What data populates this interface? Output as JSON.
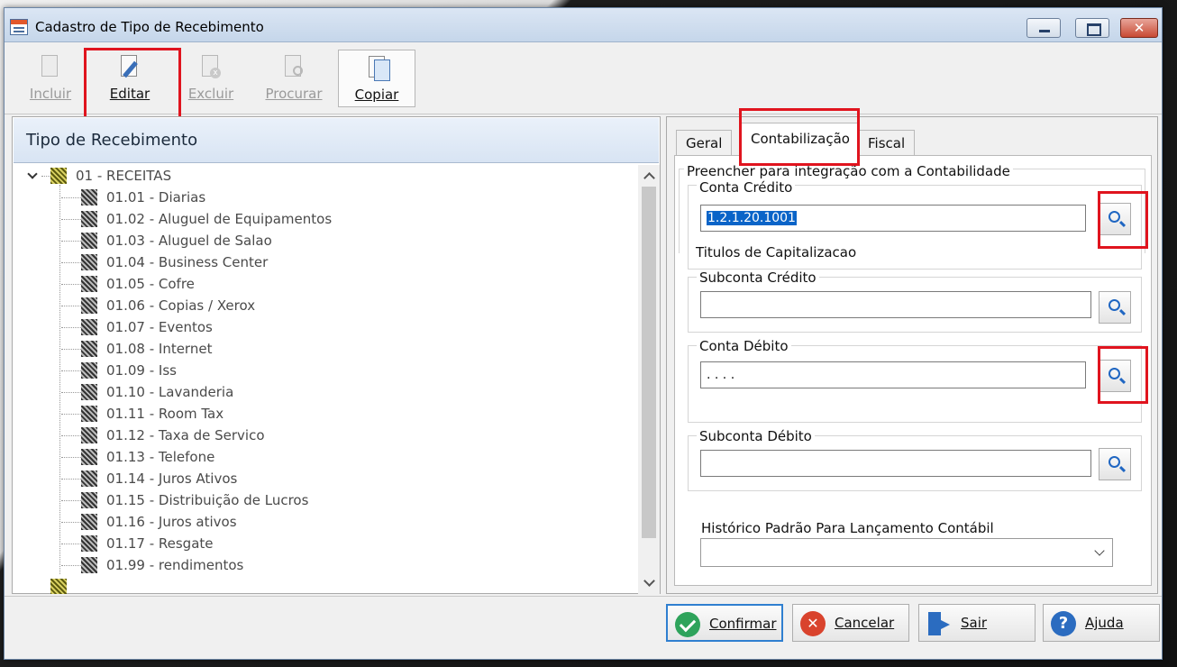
{
  "window": {
    "title": "Cadastro de Tipo de Recebimento",
    "close_glyph": "✕"
  },
  "toolbar": {
    "incluir": "Incluir",
    "editar": "Editar",
    "excluir": "Excluir",
    "procurar": "Procurar",
    "copiar": "Copiar"
  },
  "tree": {
    "header": "Tipo de Recebimento",
    "root": "01 - RECEITAS",
    "items": [
      "01.01 - Diarias",
      "01.02 - Aluguel de Equipamentos",
      "01.03 - Aluguel de Salao",
      "01.04 - Business Center",
      "01.05 - Cofre",
      "01.06 - Copias / Xerox",
      "01.07 - Eventos",
      "01.08 - Internet",
      "01.09 - Iss",
      "01.10 - Lavanderia",
      "01.11 - Room Tax",
      "01.12 - Taxa de Servico",
      "01.13 - Telefone",
      "01.14 - Juros Ativos",
      "01.15 - Distribuição de Lucros",
      "01.16 - Juros ativos",
      "01.17 - Resgate",
      "01.99 - rendimentos"
    ]
  },
  "tabs": {
    "geral": "Geral",
    "contabilizacao": "Contabilização",
    "fiscal": "Fiscal"
  },
  "form": {
    "group_title": "Preencher para integração com a Contabilidade",
    "conta_credito_label": "Conta Crédito",
    "conta_credito_value": "1.2.1.20.1001",
    "conta_credito_desc": "Titulos de Capitalizacao",
    "subconta_credito_label": "Subconta Crédito",
    "subconta_credito_value": "",
    "conta_debito_label": "Conta Débito",
    "conta_debito_value": ". . . .",
    "subconta_debito_label": "Subconta Débito",
    "subconta_debito_value": "",
    "historico_label": "Histórico Padrão Para Lançamento Contábil",
    "historico_value": ""
  },
  "actions": {
    "confirmar": "Confirmar",
    "cancelar": "Cancelar",
    "cancel_glyph": "✕",
    "sair": "Sair",
    "ajuda": "Ajuda",
    "help_glyph": "?"
  }
}
